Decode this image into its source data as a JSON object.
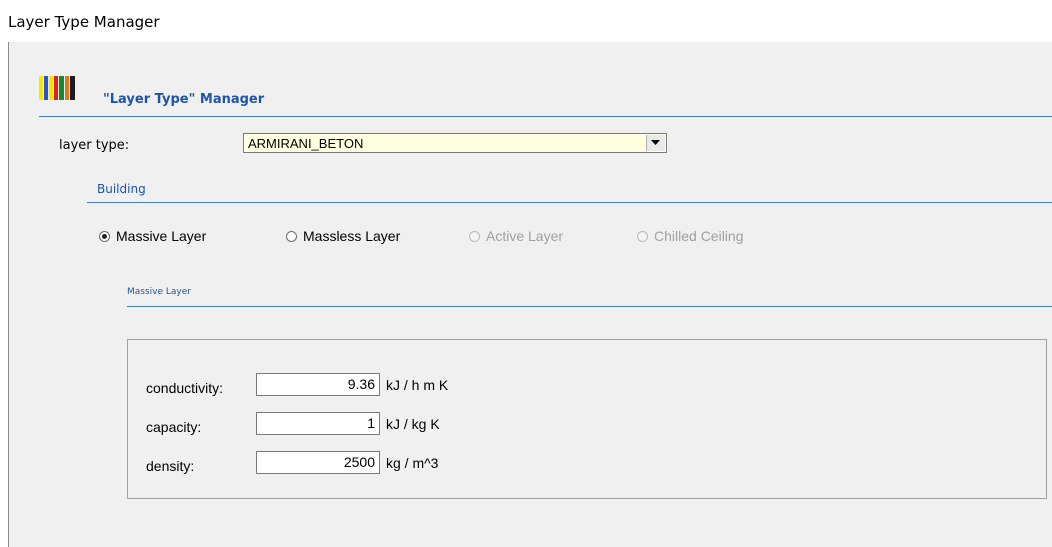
{
  "window": {
    "title": "Layer Type Manager"
  },
  "header": {
    "label": "\"Layer Type\" Manager",
    "logo_colors": [
      "#f7e600",
      "#2a4fd8",
      "#e01f1f",
      "#1c8a2c",
      "#e07a1a",
      "#1c1c1c"
    ]
  },
  "layer_type": {
    "label": "layer type:",
    "selected": "ARMIRANI_BETON",
    "dropdown_icon": "chevron-down-icon"
  },
  "building": {
    "title": "Building",
    "options": [
      {
        "label": "Massive Layer",
        "checked": true,
        "enabled": true
      },
      {
        "label": "Massless Layer",
        "checked": false,
        "enabled": true
      },
      {
        "label": "Active Layer",
        "checked": false,
        "enabled": false
      },
      {
        "label": "Chilled Ceiling",
        "checked": false,
        "enabled": false
      }
    ]
  },
  "massive_layer": {
    "title": "Massive Layer",
    "fields": [
      {
        "label": "conductivity:",
        "value": "9.36",
        "unit": "kJ / h m K"
      },
      {
        "label": "capacity:",
        "value": "1",
        "unit": "kJ / kg K"
      },
      {
        "label": "density:",
        "value": "2500",
        "unit": "kg / m^3"
      }
    ]
  },
  "colors": {
    "accent": "#2054a8",
    "line": "#4a7fc4",
    "combo_bg": "#ffffe1",
    "panel_bg": "#f0f0f0"
  }
}
